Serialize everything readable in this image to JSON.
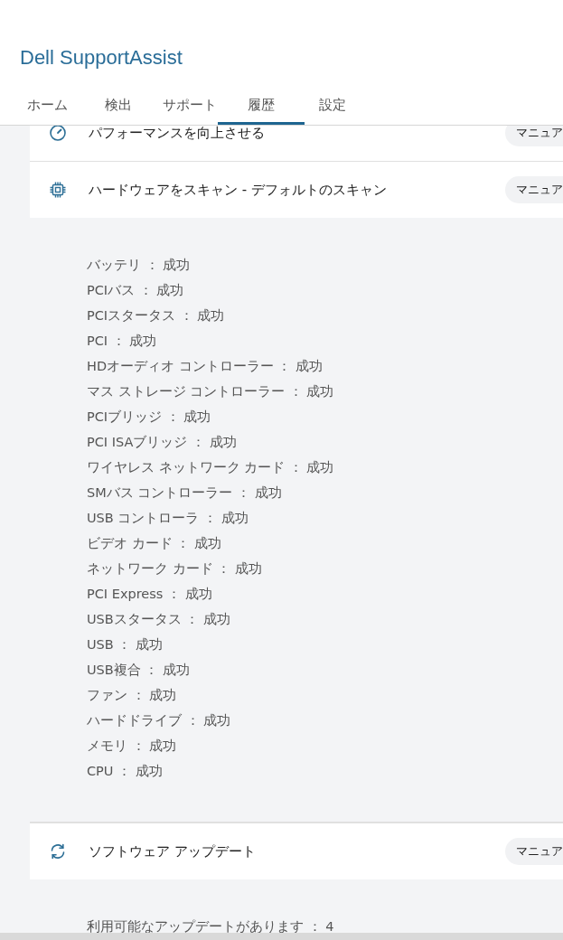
{
  "app_title": "Dell SupportAssist",
  "tabs": [
    {
      "label": "ホーム",
      "selected": false
    },
    {
      "label": "検出",
      "selected": false
    },
    {
      "label": "サポート",
      "selected": false
    },
    {
      "label": "履歴",
      "selected": true
    },
    {
      "label": "設定",
      "selected": false
    }
  ],
  "sections": [
    {
      "kind": "gauge",
      "title": "パフォーマンスを向上させる",
      "badge": "マニュア"
    },
    {
      "kind": "chip",
      "title": "ハードウェアをスキャン - デフォルトのスキャン",
      "badge": "マニュア",
      "details": [
        "バッテリ ： 成功",
        "PCIバス ： 成功",
        "PCIスタータス ： 成功",
        "PCI ： 成功",
        "HDオーディオ コントローラー ： 成功",
        "マス ストレージ コントローラー ： 成功",
        "PCIブリッジ ： 成功",
        "PCI ISAブリッジ ： 成功",
        "ワイヤレス ネットワーク カード ： 成功",
        "SMバス コントローラー ： 成功",
        "USB コントローラ ： 成功",
        "ビデオ カード ： 成功",
        "ネットワーク カード ： 成功",
        "PCI Express ： 成功",
        "USBスタータス ： 成功",
        "USB ： 成功",
        "USB複合 ： 成功",
        "ファン ： 成功",
        "ハードドライブ ： 成功",
        "メモリ ： 成功",
        "CPU ： 成功"
      ]
    },
    {
      "kind": "refresh",
      "title": "ソフトウェア アップデート",
      "badge": "マニュア",
      "details": [
        "利用可能なアップデートがあります ： 4"
      ]
    }
  ]
}
